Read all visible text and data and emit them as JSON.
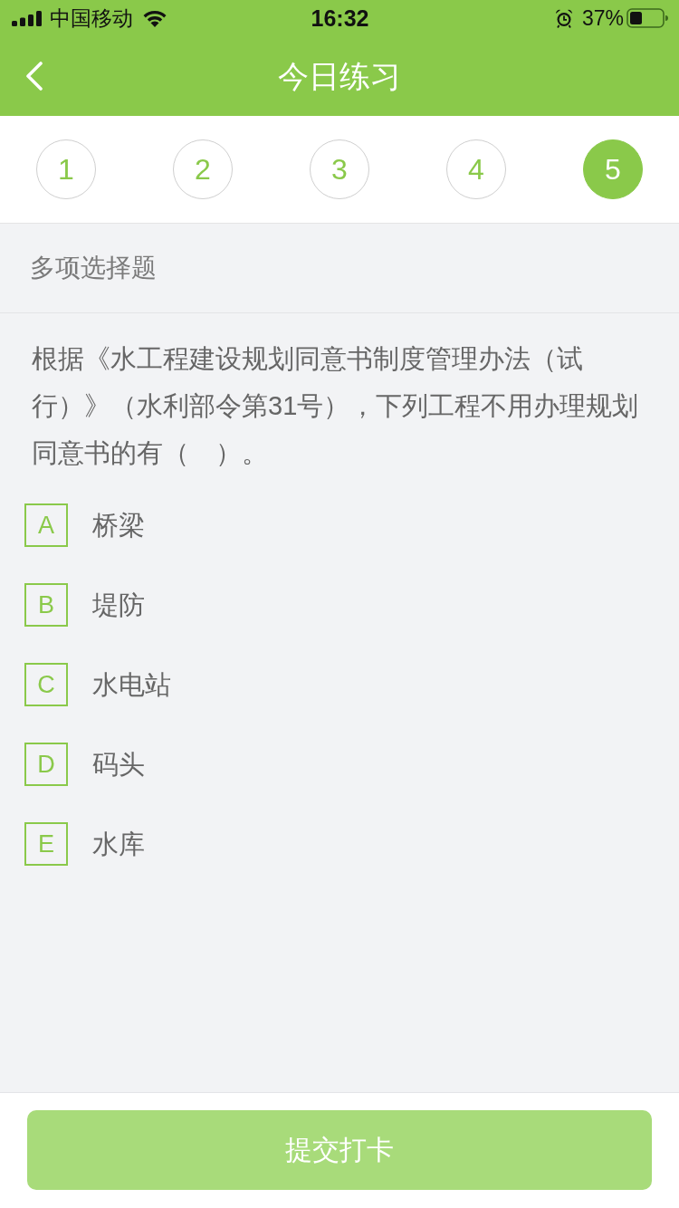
{
  "status_bar": {
    "carrier": "中国移动",
    "time": "16:32",
    "battery": "37%"
  },
  "nav": {
    "title": "今日练习"
  },
  "question_tabs": [
    {
      "label": "1",
      "selected": false
    },
    {
      "label": "2",
      "selected": false
    },
    {
      "label": "3",
      "selected": false
    },
    {
      "label": "4",
      "selected": false
    },
    {
      "label": "5",
      "selected": true
    }
  ],
  "question": {
    "type": "多项选择题",
    "text": "根据《水工程建设规划同意书制度管理办法（试行）》（水利部令第31号），下列工程不用办理规划同意书的有（　）。",
    "options": [
      {
        "letter": "A",
        "text": "桥梁",
        "selected": false
      },
      {
        "letter": "B",
        "text": "堤防",
        "selected": false
      },
      {
        "letter": "C",
        "text": "水电站",
        "selected": false
      },
      {
        "letter": "D",
        "text": "码头",
        "selected": false
      },
      {
        "letter": "E",
        "text": "水库",
        "selected": false
      }
    ]
  },
  "submit_button": {
    "label": "提交打卡",
    "disabled": true
  }
}
